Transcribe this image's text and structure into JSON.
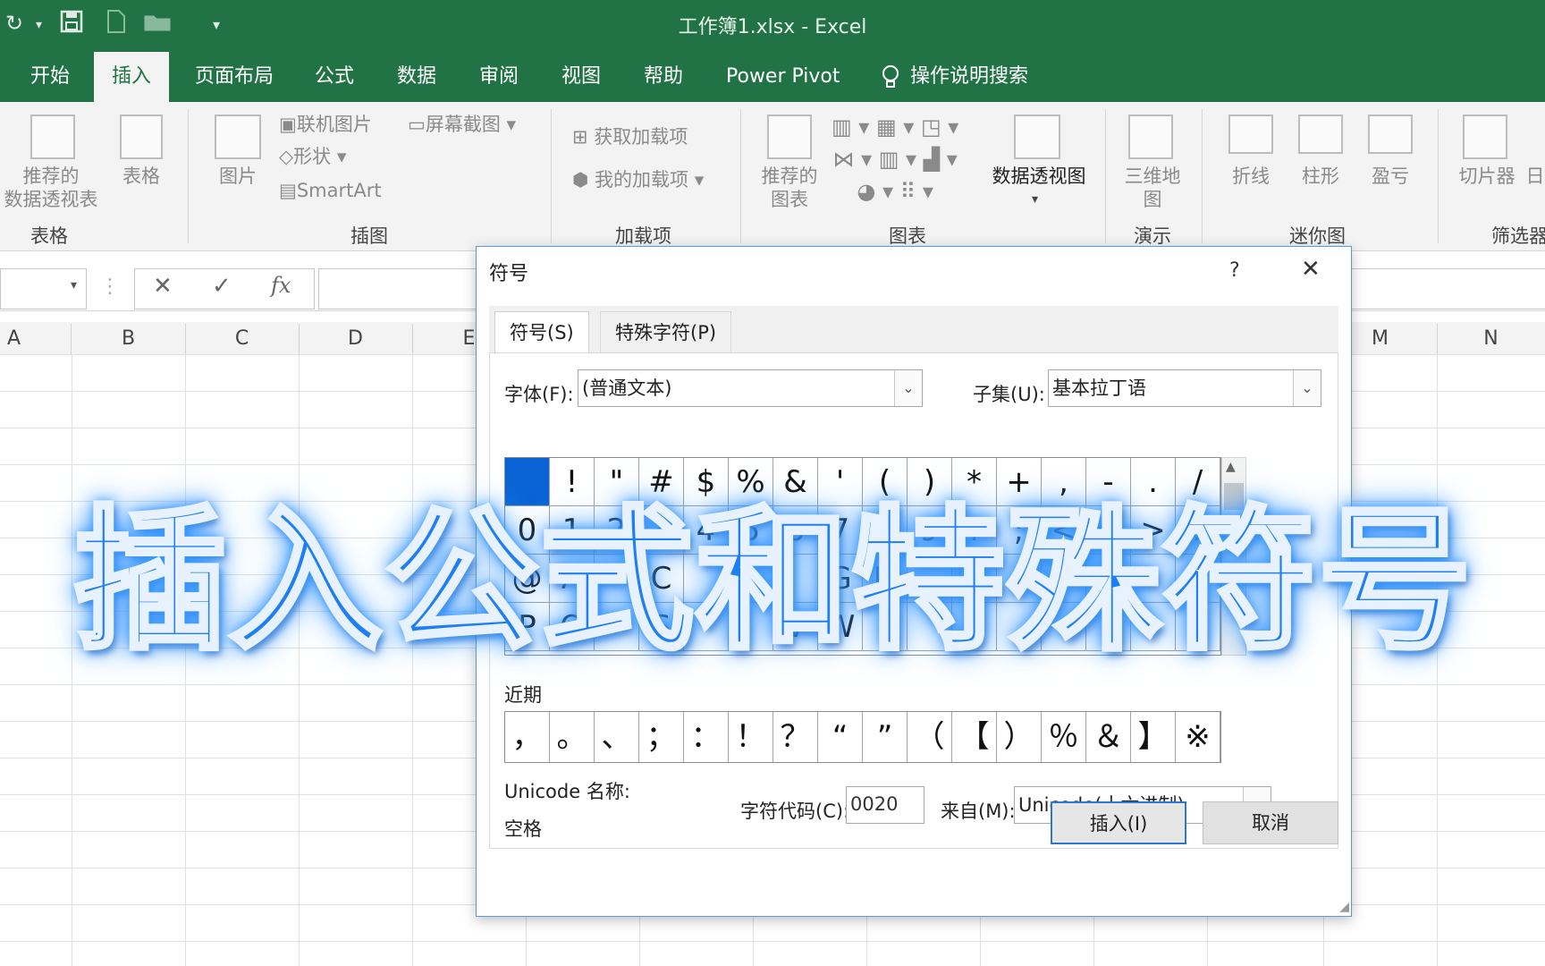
{
  "window": {
    "title": "工作簿1.xlsx  -  Excel"
  },
  "quick_access": {
    "redo_icon": "redo-icon",
    "save_icon": "save-icon",
    "new_icon": "new-file-icon",
    "open_icon": "open-folder-icon",
    "customize": "▾"
  },
  "menu": {
    "tabs": [
      "开始",
      "插入",
      "页面布局",
      "公式",
      "数据",
      "审阅",
      "视图",
      "帮助",
      "Power Pivot"
    ],
    "active": "插入",
    "search": "操作说明搜索"
  },
  "ribbon": {
    "groups": [
      {
        "label": "表格",
        "items": [
          "推荐的\n数据透视表",
          "表格"
        ]
      },
      {
        "label": "插图",
        "items": [
          "图片",
          "联机图片",
          "形状",
          "SmartArt",
          "屏幕截图"
        ]
      },
      {
        "label": "加载项",
        "items": [
          "获取加载项",
          "我的加载项"
        ]
      },
      {
        "label": "图表",
        "items": [
          "推荐的\n图表",
          "数据透视图"
        ]
      },
      {
        "label": "演示",
        "items": [
          "三维地\n图"
        ]
      },
      {
        "label": "迷你图",
        "items": [
          "折线",
          "柱形",
          "盈亏"
        ]
      },
      {
        "label": "筛选器",
        "items": [
          "切片器",
          "日"
        ]
      }
    ]
  },
  "formula_bar": {
    "cancel": "✕",
    "enter": "✓",
    "fx": "fx"
  },
  "columns": [
    "A",
    "B",
    "C",
    "D",
    "E",
    "M",
    "N"
  ],
  "dialog": {
    "title": "符号",
    "help": "?",
    "close": "✕",
    "tabs": [
      "符号(S)",
      "特殊字符(P)"
    ],
    "font_label": "字体(F):",
    "font_value": "(普通文本)",
    "subset_label": "子集(U):",
    "subset_value": "基本拉丁语",
    "symbol_rows": [
      [
        " ",
        "!",
        "\"",
        "#",
        "$",
        "%",
        "&",
        "'",
        "(",
        ")",
        "*",
        "+",
        ",",
        "-",
        ".",
        "/"
      ],
      [
        "0",
        "1",
        "2",
        "3",
        "4",
        "5",
        "6",
        "7",
        "8",
        "9",
        ":",
        ";",
        "<",
        "=",
        ">",
        "?"
      ],
      [
        "@",
        "A",
        "",
        "C",
        "",
        "",
        "",
        "G",
        "H",
        "",
        "",
        "",
        "",
        "M",
        "",
        ""
      ],
      [
        "P",
        "Q",
        "",
        "S",
        "",
        "",
        "V",
        "W",
        "",
        "",
        "",
        "",
        "",
        "",
        "",
        ""
      ]
    ],
    "recent_label": "近期",
    "recent_symbols": [
      "，",
      "。",
      "、",
      "；",
      "：",
      "！",
      "？",
      "“",
      "”",
      "（",
      "【",
      "）",
      "％",
      "＆",
      "】",
      "※"
    ],
    "unicode_name_label": "Unicode 名称:",
    "unicode_name_value": "空格",
    "char_code_label": "字符代码(C):",
    "char_code_value": "0020",
    "from_label": "来自(M):",
    "from_value": "Unicode(十六进制)",
    "insert_button": "插入(I)",
    "cancel_button": "取消"
  },
  "overlay": {
    "headline": "插入公式和特殊符号",
    "color": "#1e7ff5"
  },
  "colors": {
    "excel_green": "#217346",
    "selection_blue": "#0a64d6"
  }
}
